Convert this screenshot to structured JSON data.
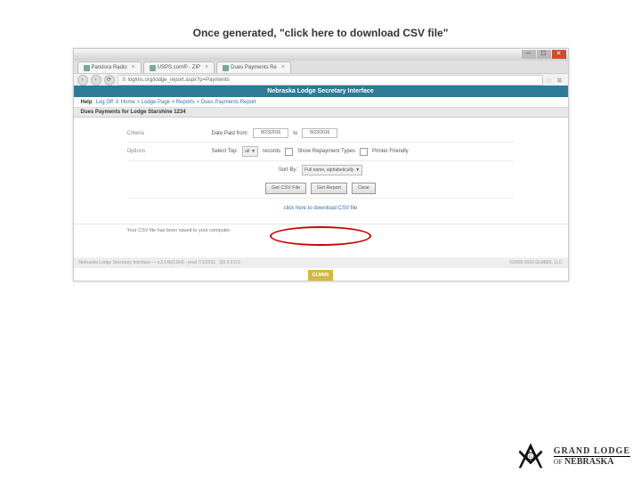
{
  "caption": "Once generated, \"click here to download CSV file\"",
  "browser": {
    "tabs": [
      {
        "label": "Pandora Radio"
      },
      {
        "label": "USPS.com® - ZIP"
      },
      {
        "label": "Dues Payments Re"
      }
    ],
    "url": "① loglms.org/lodge_report.aspx?p=Payments"
  },
  "app": {
    "title": "Nebraska Lodge Secretary Interface",
    "help_label": "Help",
    "breadcrumb": "Log Off  ①  Home  >  Lodge Page  >  Reports  >  Dues Payments Report",
    "section": "Dues Payments for Lodge Starshine 1234"
  },
  "form": {
    "criteria_label": "Criteria",
    "date_label": "Date Paid from:",
    "date_from": "8/23/2016",
    "date_to_label": "to",
    "date_to": "8/23/2016",
    "options_label": "Options",
    "select_top": "Select Top:",
    "select_value": "all",
    "records": "records",
    "show_repayment": "Show Repayment Types",
    "printer_friendly": "Printer Friendly",
    "sort_by": "Sort By:",
    "sort_value": "Full name, alphabetically",
    "btn_csv": "Get CSV File",
    "btn_report": "Get Report",
    "btn_clear": "Clear"
  },
  "download": {
    "link_text": "click here to download CSV file",
    "saved_msg": "Your CSV file has been saved to your computer."
  },
  "footer": {
    "left": "Nebraska Lodge Secretary Interface  —  v.3.14b(1164) - prod 7/1/2016 · Q3 3.0.0.0",
    "right": "©2008-2016 GLMMS, LLC",
    "badge": "GLMMS"
  },
  "branding": {
    "line1": "GRAND LODGE",
    "line2_of": "OF",
    "line2_state": "NEBRASKA"
  }
}
